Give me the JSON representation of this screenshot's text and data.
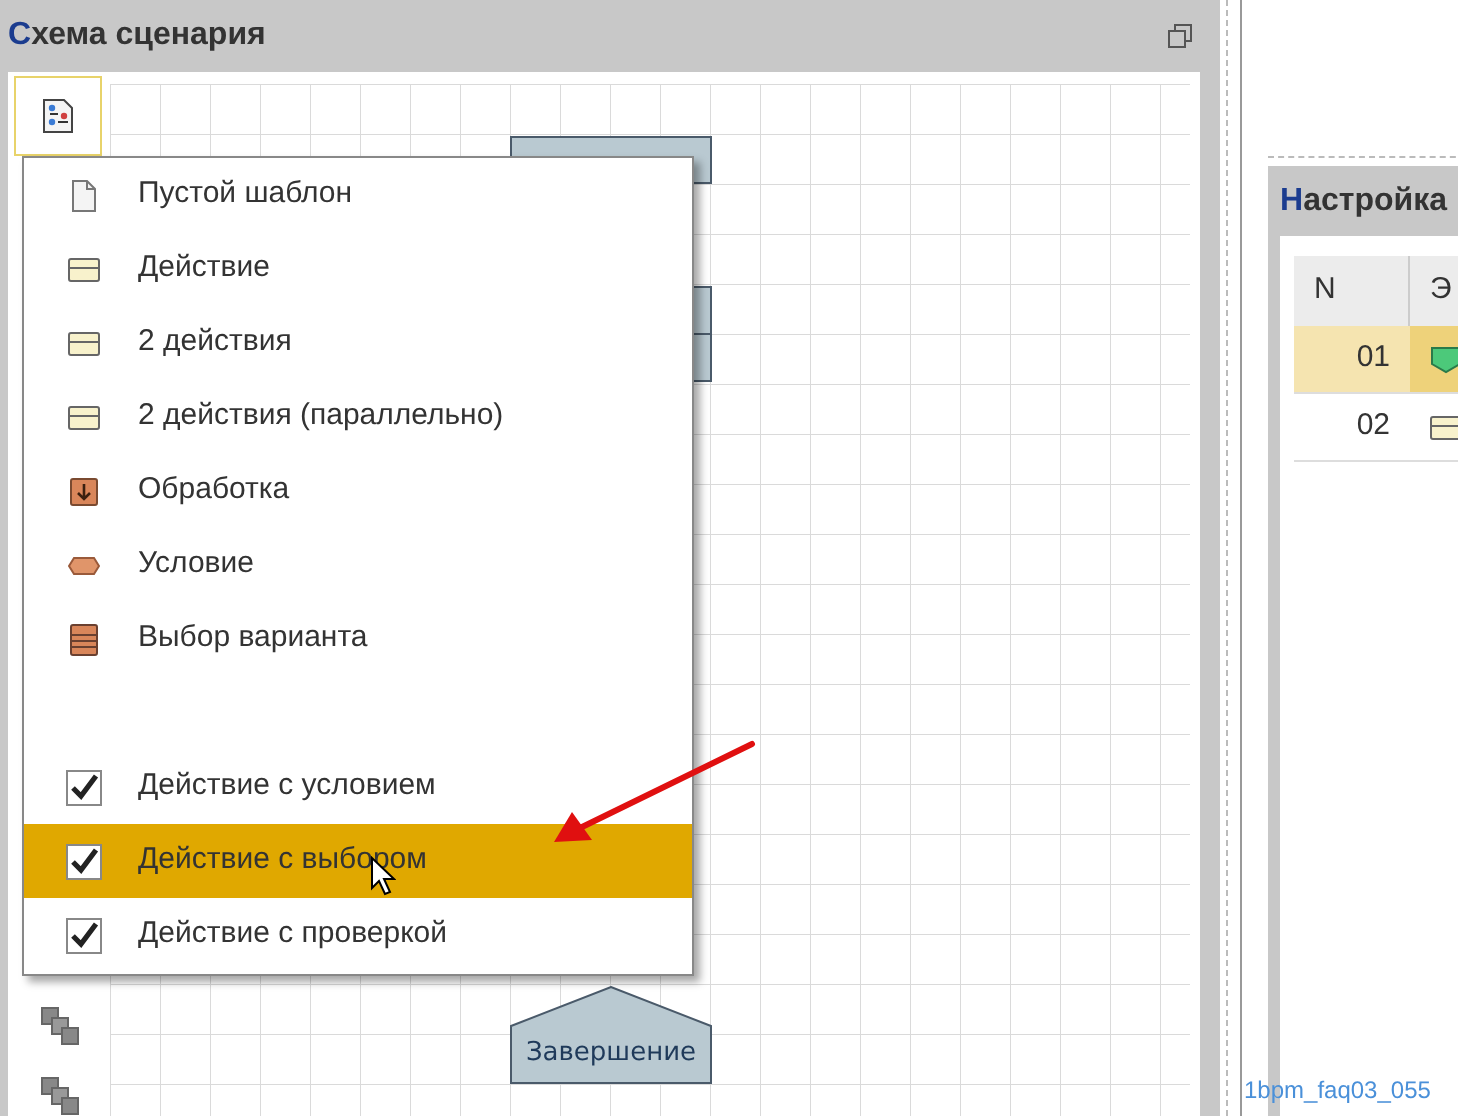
{
  "left_panel": {
    "title": "Схема сценария"
  },
  "menu": {
    "items": [
      {
        "label": "Пустой шаблон",
        "kind": "blank",
        "selected": false
      },
      {
        "label": "Действие",
        "kind": "action",
        "selected": false
      },
      {
        "label": "2 действия",
        "kind": "action",
        "selected": false
      },
      {
        "label": "2 действия (параллельно)",
        "kind": "action",
        "selected": false
      },
      {
        "label": "Обработка",
        "kind": "processing",
        "selected": false
      },
      {
        "label": "Условие",
        "kind": "condition",
        "selected": false
      },
      {
        "label": "Выбор варианта",
        "kind": "choice",
        "selected": false
      },
      {
        "label": "Действие с условием",
        "kind": "check",
        "checked": true,
        "selected": false
      },
      {
        "label": "Действие с выбором",
        "kind": "check",
        "checked": true,
        "selected": true
      },
      {
        "label": "Действие с проверкой",
        "kind": "check",
        "checked": true,
        "selected": false
      }
    ]
  },
  "diagram": {
    "end_node": "Завершение"
  },
  "right_panel": {
    "title": "Настройка",
    "table": {
      "columns": [
        "N",
        "Э"
      ],
      "rows": [
        {
          "n": "01",
          "kind": "start",
          "selected": true
        },
        {
          "n": "02",
          "kind": "action",
          "selected": false
        }
      ]
    }
  },
  "caption": "1bpm_faq03_055"
}
